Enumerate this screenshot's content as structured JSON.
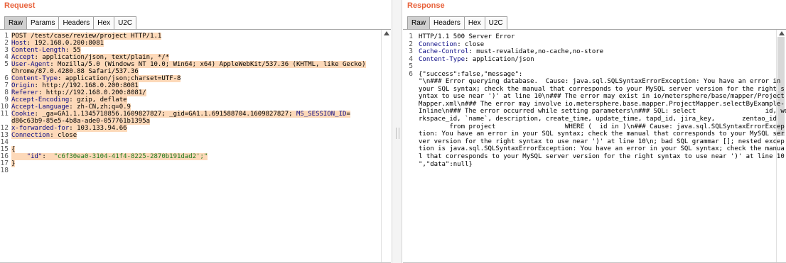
{
  "request": {
    "title": "Request",
    "tabs": [
      "Raw",
      "Params",
      "Headers",
      "Hex",
      "U2C"
    ],
    "lines": [
      {
        "n": "1",
        "parts": [
          {
            "t": "POST /test/case/review/project HTTP/1.1",
            "c": "val"
          }
        ],
        "hl": true
      },
      {
        "n": "2",
        "parts": [
          {
            "t": "Host",
            "c": "kw"
          },
          {
            "t": ": 192.168.0.200:8081",
            "c": "val"
          }
        ],
        "hl": true
      },
      {
        "n": "3",
        "parts": [
          {
            "t": "Content-Length",
            "c": "kw"
          },
          {
            "t": ": 55",
            "c": "val"
          }
        ],
        "hl": true
      },
      {
        "n": "4",
        "parts": [
          {
            "t": "Accept",
            "c": "kw"
          },
          {
            "t": ": application/json, text/plain, */*",
            "c": "val"
          }
        ],
        "hl": true
      },
      {
        "n": "5",
        "parts": [
          {
            "t": "User-Agent",
            "c": "kw"
          },
          {
            "t": ": Mozilla/5.0 (Windows NT 10.0; Win64; x64) AppleWebKit/537.36 (KHTML, like Gecko)",
            "c": "val"
          }
        ],
        "hl": true
      },
      {
        "n": "",
        "parts": [
          {
            "t": "Chrome/87.0.4280.88 Safari/537.36",
            "c": "val"
          }
        ],
        "hl": true
      },
      {
        "n": "6",
        "parts": [
          {
            "t": "Content-Type",
            "c": "kw"
          },
          {
            "t": ": application/json;charset=UTF-8",
            "c": "val"
          }
        ],
        "hl": true
      },
      {
        "n": "7",
        "parts": [
          {
            "t": "Origin",
            "c": "kw"
          },
          {
            "t": ": http://192.168.0.200:8081",
            "c": "val"
          }
        ],
        "hl": true
      },
      {
        "n": "8",
        "parts": [
          {
            "t": "Referer",
            "c": "kw"
          },
          {
            "t": ": http://192.168.0.200:8081/",
            "c": "val"
          }
        ],
        "hl": true
      },
      {
        "n": "9",
        "parts": [
          {
            "t": "Accept-Encoding",
            "c": "kw"
          },
          {
            "t": ": gzip, deflate",
            "c": "val"
          }
        ],
        "hl": true
      },
      {
        "n": "10",
        "parts": [
          {
            "t": "Accept-Language",
            "c": "kw"
          },
          {
            "t": ": zh-CN,zh;q=0.9",
            "c": "val"
          }
        ],
        "hl": true
      },
      {
        "n": "11",
        "parts": [
          {
            "t": "Cookie",
            "c": "kw"
          },
          {
            "t": ": _ga=GA1.1.1345718856.1609827827; _gid=GA1.1.691588704.1609827827; ",
            "c": "val"
          },
          {
            "t": "MS_SESSION_ID",
            "c": "kw"
          },
          {
            "t": "=",
            "c": "val"
          }
        ],
        "hl": true
      },
      {
        "n": "",
        "parts": [
          {
            "t": "d86c63b9-85e5-4b8a-ade0-057761b1395a",
            "c": "val"
          }
        ],
        "hl": true
      },
      {
        "n": "12",
        "parts": [
          {
            "t": "x-forwarded-for",
            "c": "kw"
          },
          {
            "t": ": 103.133.94.66",
            "c": "val"
          }
        ],
        "hl": true
      },
      {
        "n": "13",
        "parts": [
          {
            "t": "Connection",
            "c": "kw"
          },
          {
            "t": ": close",
            "c": "val"
          }
        ],
        "hl": true
      },
      {
        "n": "14",
        "parts": [],
        "hl": false
      },
      {
        "n": "15",
        "parts": [
          {
            "t": "{",
            "c": "val"
          }
        ],
        "hl": true
      },
      {
        "n": "16",
        "parts": [
          {
            "t": "    \"id\"",
            "c": "kw"
          },
          {
            "t": ":  ",
            "c": "val"
          },
          {
            "t": "\"c6f30ea0-3104-41f4-8225-2870b191dad2';\"",
            "c": "str"
          }
        ],
        "hl": true
      },
      {
        "n": "17",
        "parts": [
          {
            "t": "}",
            "c": "val"
          }
        ],
        "hl": true
      },
      {
        "n": "18",
        "parts": [],
        "hl": false
      }
    ]
  },
  "response": {
    "title": "Response",
    "tabs": [
      "Raw",
      "Headers",
      "Hex",
      "U2C"
    ],
    "header_lines": [
      {
        "n": "1",
        "parts": [
          {
            "t": "HTTP/1.1 500 Server Error",
            "c": "val"
          }
        ]
      },
      {
        "n": "2",
        "parts": [
          {
            "t": "Connection",
            "c": "kw"
          },
          {
            "t": ": close",
            "c": "val"
          }
        ]
      },
      {
        "n": "3",
        "parts": [
          {
            "t": "Cache-Control",
            "c": "kw"
          },
          {
            "t": ": must-revalidate,no-cache,no-store",
            "c": "val"
          }
        ]
      },
      {
        "n": "4",
        "parts": [
          {
            "t": "Content-Type",
            "c": "kw"
          },
          {
            "t": ": application/json",
            "c": "val"
          }
        ]
      },
      {
        "n": "5",
        "parts": []
      }
    ],
    "body_line_number": "6",
    "body_lines": [
      "{\"success\":false,\"message\":",
      "\"\\n### Error querying database.  Cause: java.sql.SQLSyntaxErrorException: You have an error in",
      "your SQL syntax; check the manual that corresponds to your MySQL server version for the right s",
      "yntax to use near ')' at line 10\\n### The error may exist in io/metersphere/base/mapper/Project",
      "Mapper.xml\\n### The error may involve io.metersphere.base.mapper.ProjectMapper.selectByExample-",
      "Inline\\n### The error occurred while setting parameters\\n### SQL: select                  id, wo",
      "rkspace_id, `name`, description, create_time, update_time, tapd_id, jira_key,       zentao_id",
      "        from project                  WHERE (  id in )\\n### Cause: java.sql.SQLSyntaxErrorExcep",
      "tion: You have an error in your SQL syntax; check the manual that corresponds to your MySQL ser",
      "ver version for the right syntax to use near ')' at line 10\\n; bad SQL grammar []; nested excep",
      "tion is java.sql.SQLSyntaxErrorException: You have an error in your SQL syntax; check the manua",
      "l that corresponds to your MySQL server version for the right syntax to use near ')' at line 10",
      "\",\"data\":null}"
    ]
  }
}
